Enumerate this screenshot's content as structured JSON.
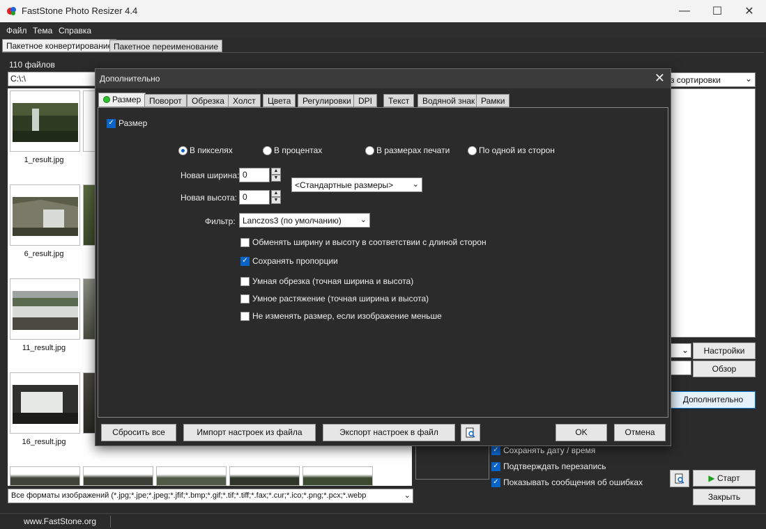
{
  "window": {
    "title": "FastStone Photo Resizer 4.4",
    "controls": {
      "minimize": "—",
      "maximize": "☐",
      "close": "✕"
    }
  },
  "menu": [
    "Файл",
    "Тема",
    "Справка"
  ],
  "main_tabs": [
    "Пакетное конвертирование",
    "Пакетное переименование"
  ],
  "files_count": "110 файлов",
  "path": "C:\\:\\",
  "thumbnails": [
    {
      "label": "1_result.jpg"
    },
    {
      "label": "6_result.jpg"
    },
    {
      "label": "11_result.jpg"
    },
    {
      "label": "16_result.jpg"
    }
  ],
  "formats_filter": "Все форматы изображений (*.jpg;*.jpe;*.jpeg;*.jfif;*.bmp;*.gif;*.tif;*.tiff;*.fax;*.cur;*.ico;*.png;*.pcx;*.webp",
  "sort_combo": "з сортировки",
  "right_buttons": {
    "settings": "Настройки",
    "browse": "Обзор",
    "advanced": "Дополнительно",
    "start": "Старт",
    "close": "Закрыть"
  },
  "right_checks": [
    {
      "label": "Сохранять дату / время",
      "checked": true
    },
    {
      "label": "Подтверждать перезапись",
      "checked": true
    },
    {
      "label": "Показывать сообщения об ошибках",
      "checked": true
    }
  ],
  "status": {
    "site": "www.FastStone.org"
  },
  "dialog": {
    "title": "Дополнительно",
    "close": "✕",
    "tabs": [
      "Размер",
      "Поворот",
      "Обрезка",
      "Холст",
      "Цвета",
      "Регулировки",
      "DPI",
      "Текст",
      "Водяной знак",
      "Рамки"
    ],
    "resize_checkbox": "Размер",
    "modes": [
      {
        "label": "В пикселях",
        "selected": true
      },
      {
        "label": "В процентах",
        "selected": false
      },
      {
        "label": "В размерах печати",
        "selected": false
      },
      {
        "label": "По одной из сторон",
        "selected": false
      }
    ],
    "width_label": "Новая ширина:",
    "width_value": "0",
    "height_label": "Новая высота:",
    "height_value": "0",
    "standard_sizes": "<Стандартные размеры>",
    "filter_label": "Фильтр:",
    "filter_value": "Lanczos3 (по умолчанию)",
    "options": [
      {
        "label": "Обменять ширину и высоту в соответствии с длиной сторон",
        "checked": false
      },
      {
        "label": "Сохранять пропорции",
        "checked": true
      },
      {
        "label": "Умная обрезка (точная ширина и высота)",
        "checked": false
      },
      {
        "label": "Умное растяжение (точная ширина и высота)",
        "checked": false
      },
      {
        "label": "Не изменять размер, если изображение меньше",
        "checked": false
      }
    ],
    "buttons": {
      "reset": "Сбросить все",
      "import": "Импорт настроек из файла",
      "export": "Экспорт настроек в файл",
      "ok": "OK",
      "cancel": "Отмена"
    }
  }
}
